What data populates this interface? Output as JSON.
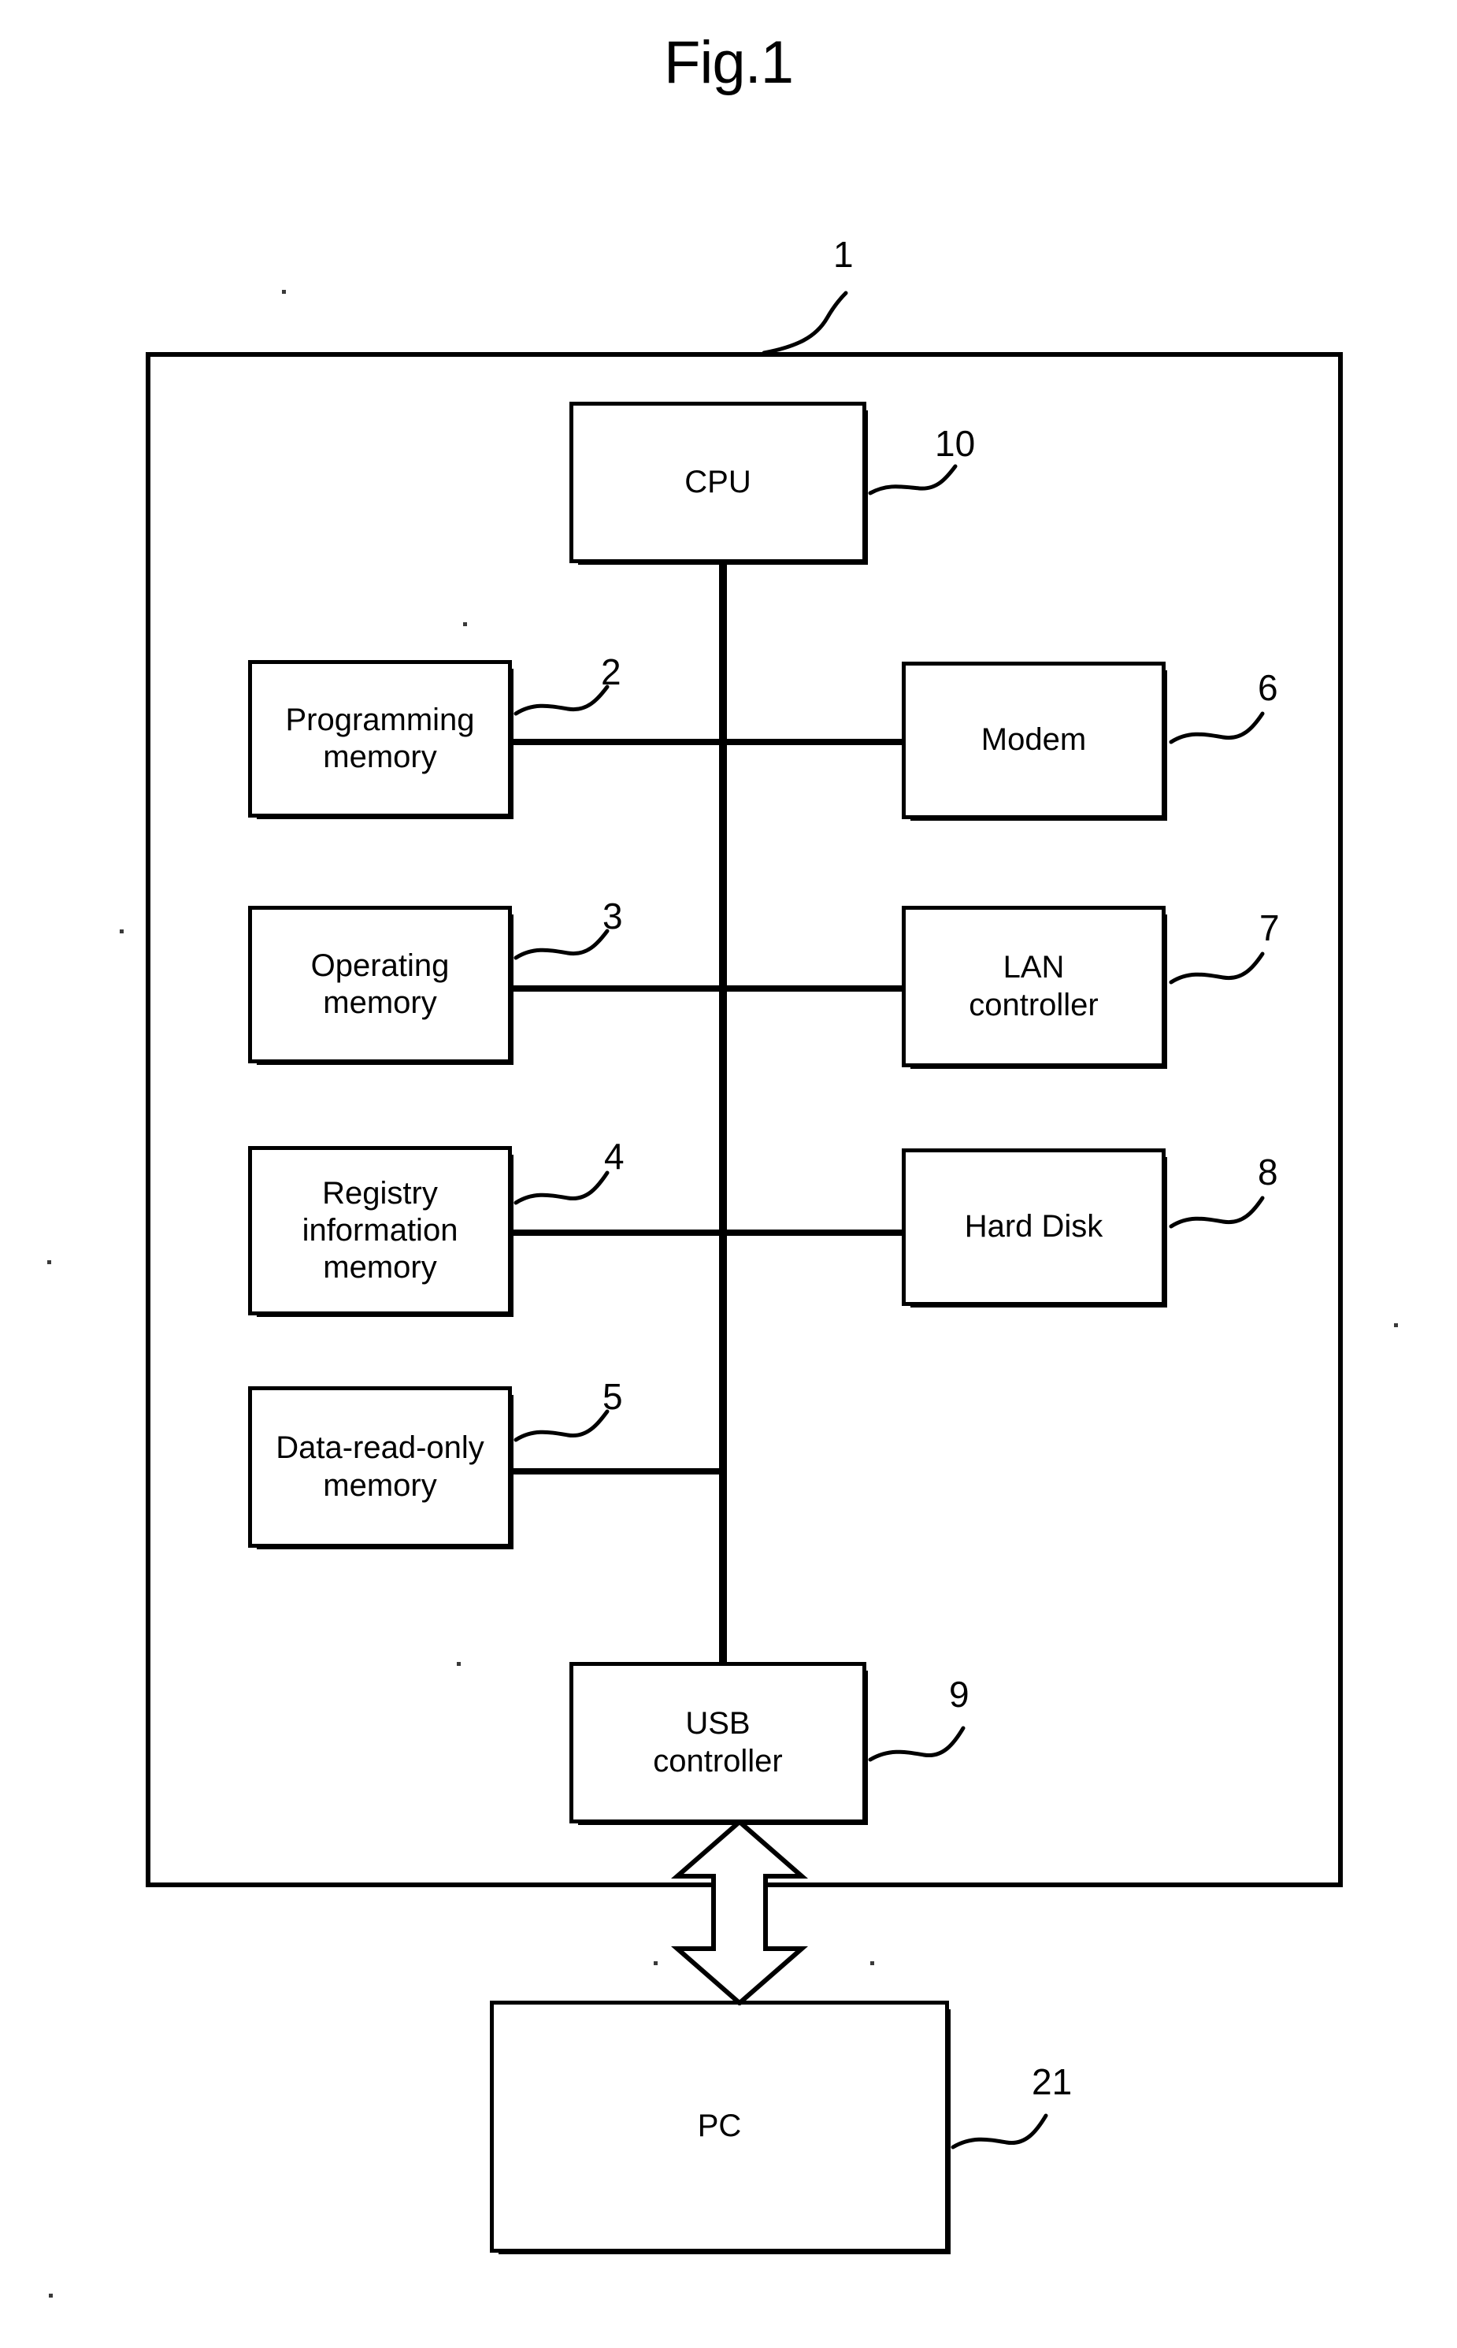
{
  "figure": {
    "title": "Fig.1"
  },
  "diagram": {
    "type": "block-diagram",
    "enclosure": {
      "ref": "1",
      "name": "apparatus-enclosure"
    },
    "nodes": [
      {
        "id": "cpu",
        "label": "CPU",
        "ref": "10"
      },
      {
        "id": "prog-mem",
        "label": "Programming\nmemory",
        "ref": "2"
      },
      {
        "id": "modem",
        "label": "Modem",
        "ref": "6"
      },
      {
        "id": "oper-mem",
        "label": "Operating\nmemory",
        "ref": "3"
      },
      {
        "id": "lan-ctrl",
        "label": "LAN\ncontroller",
        "ref": "7"
      },
      {
        "id": "reg-mem",
        "label": "Registry\ninformation\nmemory",
        "ref": "4"
      },
      {
        "id": "hard-disk",
        "label": "Hard Disk",
        "ref": "8"
      },
      {
        "id": "data-rom",
        "label": "Data-read-only\nmemory",
        "ref": "5"
      },
      {
        "id": "usb-ctrl",
        "label": "USB\ncontroller",
        "ref": "9"
      },
      {
        "id": "pc",
        "label": "PC",
        "ref": "21"
      }
    ],
    "connections": [
      {
        "from": "cpu",
        "to": "bus",
        "kind": "line"
      },
      {
        "from": "prog-mem",
        "to": "modem",
        "kind": "line"
      },
      {
        "from": "oper-mem",
        "to": "lan-ctrl",
        "kind": "line"
      },
      {
        "from": "reg-mem",
        "to": "hard-disk",
        "kind": "line"
      },
      {
        "from": "data-rom",
        "to": "bus",
        "kind": "line"
      },
      {
        "from": "bus",
        "to": "usb-ctrl",
        "kind": "line"
      },
      {
        "from": "usb-ctrl",
        "to": "pc",
        "kind": "double-arrow"
      }
    ],
    "colors": {
      "line": "#000000",
      "background": "#ffffff"
    }
  }
}
